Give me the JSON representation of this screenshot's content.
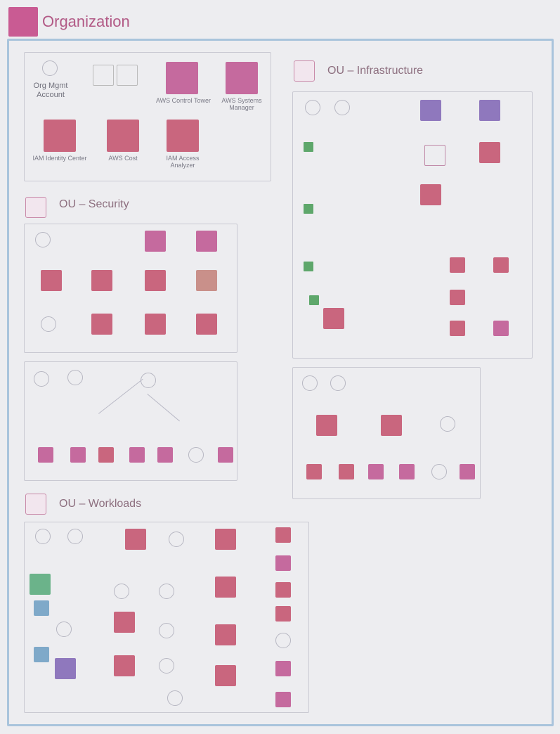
{
  "diagram": {
    "title": "Organization",
    "management": {
      "account_label": "Org Mgmt Account",
      "services": [
        {
          "label": "AWS Control Tower"
        },
        {
          "label": "AWS Systems Manager"
        },
        {
          "label": "IAM Identity Center"
        },
        {
          "label": "AWS Cost"
        },
        {
          "label": "IAM Access Analyzer"
        }
      ]
    },
    "ou_security": {
      "title": "OU – Security"
    },
    "ou_infrastructure": {
      "title": "OU – Infrastructure"
    },
    "ou_workloads": {
      "title": "OU – Workloads"
    },
    "colors": {
      "frame": "#a9c4dc",
      "service_pink": "#c56a9e",
      "service_purple": "#8f78bd",
      "accent": "#b25a86"
    }
  }
}
